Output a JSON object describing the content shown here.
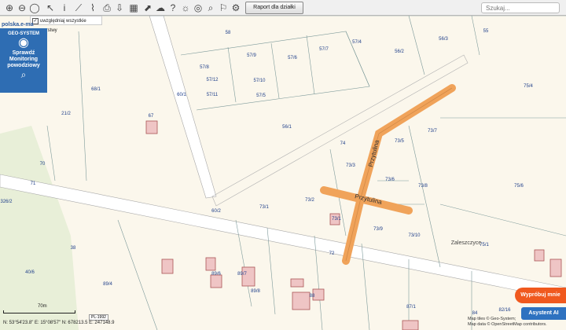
{
  "toolbar": {
    "icons": [
      "zoom-in-icon",
      "zoom-out-icon",
      "full-extent-icon",
      "globe-icon",
      "pointer-icon",
      "info-icon",
      "measure-line-icon",
      "measure-area-icon",
      "print-icon",
      "download-icon",
      "table-icon",
      "share-icon",
      "cloud-icon",
      "help-icon",
      "overlay-icon",
      "search-map-icon",
      "cart-icon",
      "settings-icon"
    ],
    "report_label": "Raport dla działki",
    "search_placeholder": "Szukaj..."
  },
  "layers_label": "uwzględniaj wszystkie warstwy",
  "domain_text": "polska.e-ma",
  "promo": {
    "brand": "GEO-SYSTEM",
    "line1": "Sprawdź",
    "line2": "Monitoring",
    "line3": "powodziowy"
  },
  "parcels": [
    "58",
    "57/8",
    "57/9",
    "57/6",
    "57/7",
    "57/4",
    "56/3",
    "55",
    "56/2",
    "57/12",
    "57/10",
    "57/11",
    "57/5",
    "68/1",
    "60/1",
    "21/2",
    "67",
    "56/1",
    "75/4",
    "73/7",
    "73/5",
    "74",
    "70",
    "71",
    "73/3",
    "73/6",
    "73/8",
    "75/6",
    "326/2",
    "60/2",
    "73/1",
    "73/2",
    "73/1",
    "73/9",
    "73/10",
    "75/1",
    "38",
    "40/6",
    "89/4",
    "72",
    "89/6",
    "89/7",
    "89/8",
    "88",
    "87/1",
    "84",
    "82/16"
  ],
  "street_label": "Przytulina",
  "area_label": "Zaleszczyce",
  "scale": "70m",
  "crs": "PL-1992",
  "coordinates": "N: 53°54'23.8\"  E: 15°08'57\"   N: 678213.5  E: 247148.9",
  "try_button": "Wypróbuj mnie",
  "ai_button": "Asystent AI",
  "attribution": [
    "Map tiles © Geo-System;",
    "Map data © OpenStreetMap contributors."
  ],
  "colors": {
    "street": "#f0a35a",
    "water_area": "#e8efd8",
    "parcel_line": "#7d9a9a",
    "promo": "#2e6db3"
  }
}
